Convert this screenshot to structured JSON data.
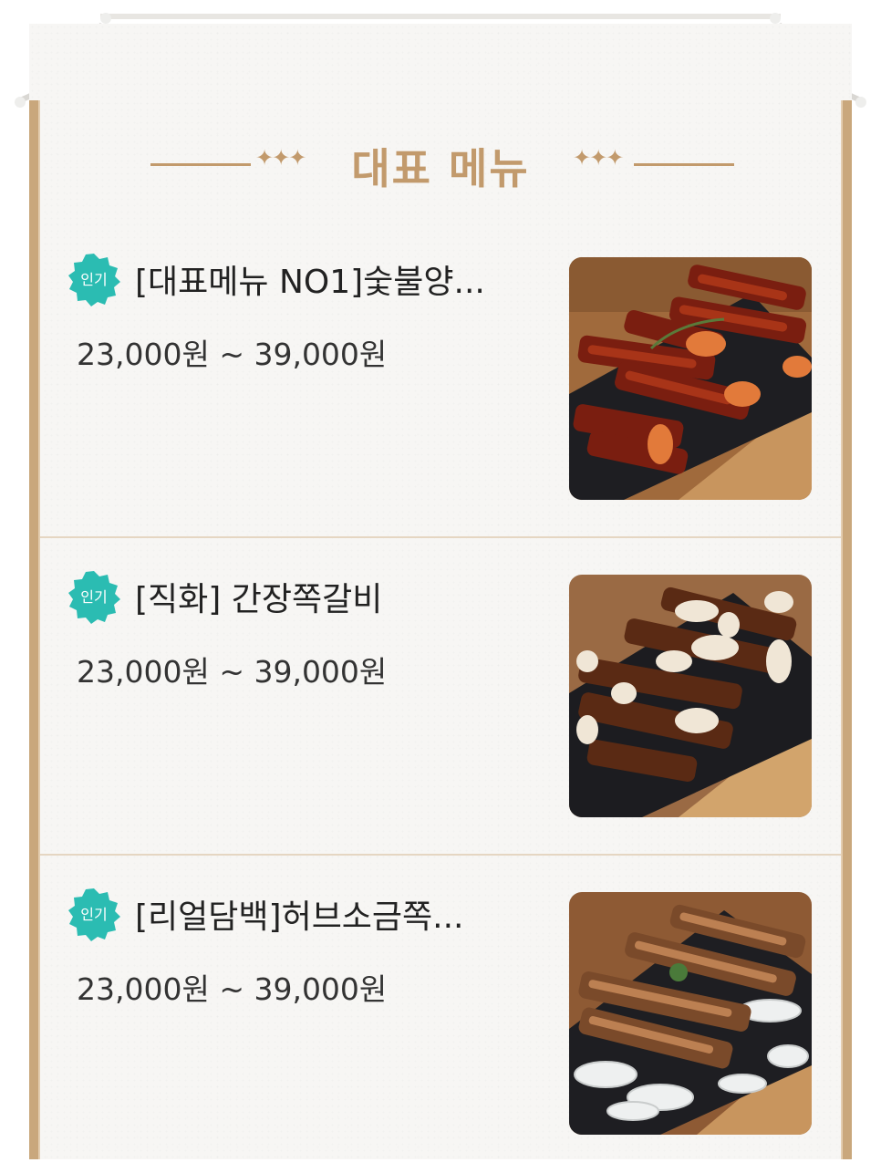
{
  "section": {
    "title": "대표 메뉴",
    "stars": "✦✦✦"
  },
  "menu": {
    "items": [
      {
        "badge": "인기",
        "name": "[대표메뉴 NO1]숯불양...",
        "price": "23,000원 ~ 39,000원",
        "image": "spicy-pork-ribs-photo"
      },
      {
        "badge": "인기",
        "name": "[직화] 간장쪽갈비",
        "price": "23,000원 ~ 39,000원",
        "image": "soy-pork-ribs-photo"
      },
      {
        "badge": "인기",
        "name": "[리얼담백]허브소금쪽...",
        "price": "23,000원 ~ 39,000원",
        "image": "herb-salt-ribs-photo"
      }
    ]
  },
  "colors": {
    "accent": "#c29a6c",
    "badge": "#2bbcb2",
    "panel_border": "#c9a77c"
  }
}
